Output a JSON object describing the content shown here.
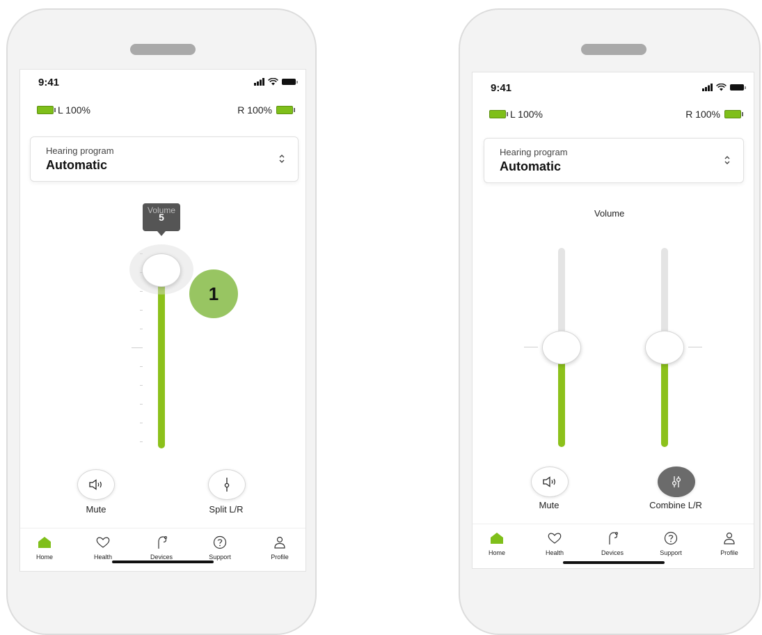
{
  "left_phone": {
    "status_bar": {
      "time": "9:41"
    },
    "battery": {
      "left": "L 100%",
      "right": "R 100%"
    },
    "program": {
      "label": "Hearing program",
      "value": "Automatic"
    },
    "volume": {
      "title": "Volume",
      "value": "5",
      "level": 0.92
    },
    "badge": "1",
    "actions": [
      {
        "label": "Mute",
        "icon": "speaker-icon"
      },
      {
        "label": "Split L/R",
        "icon": "split-slider-icon"
      }
    ],
    "tabs": [
      {
        "label": "Home",
        "icon": "home-icon",
        "active": true
      },
      {
        "label": "Health",
        "icon": "heart-icon",
        "active": false
      },
      {
        "label": "Devices",
        "icon": "hearing-aid-icon",
        "active": false
      },
      {
        "label": "Support",
        "icon": "question-icon",
        "active": false
      },
      {
        "label": "Profile",
        "icon": "person-icon",
        "active": false
      }
    ]
  },
  "right_phone": {
    "status_bar": {
      "time": "9:41"
    },
    "battery": {
      "left": "L 100%",
      "right": "R 100%"
    },
    "program": {
      "label": "Hearing program",
      "value": "Automatic"
    },
    "volume": {
      "title": "Volume",
      "left_level": 0.5,
      "right_level": 0.5
    },
    "actions": [
      {
        "label": "Mute",
        "icon": "speaker-icon"
      },
      {
        "label": "Combine L/R",
        "icon": "combine-sliders-icon"
      }
    ],
    "tabs": [
      {
        "label": "Home",
        "icon": "home-icon",
        "active": true
      },
      {
        "label": "Health",
        "icon": "heart-icon",
        "active": false
      },
      {
        "label": "Devices",
        "icon": "hearing-aid-icon",
        "active": false
      },
      {
        "label": "Support",
        "icon": "question-icon",
        "active": false
      },
      {
        "label": "Profile",
        "icon": "person-icon",
        "active": false
      }
    ]
  },
  "colors": {
    "accent": "#8cc11b",
    "badge": "#98c562",
    "tooltip": "#555555",
    "track": "#e4e4e4"
  }
}
